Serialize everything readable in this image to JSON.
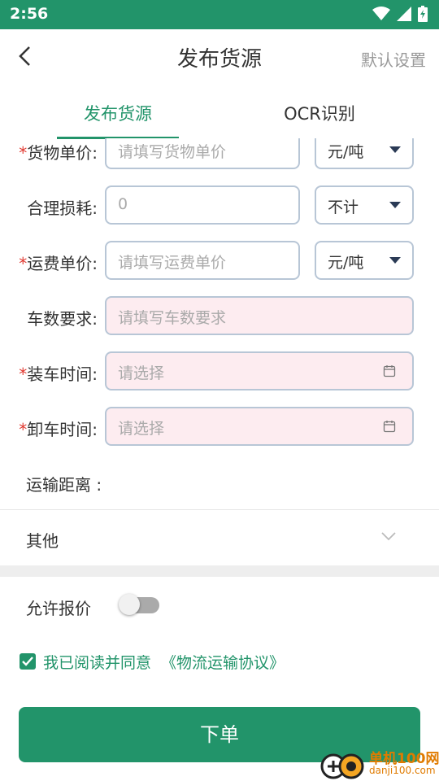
{
  "status_bar": {
    "time": "2:56"
  },
  "header": {
    "title": "发布货源",
    "right_action": "默认设置"
  },
  "tabs": [
    {
      "label": "发布货源",
      "active": true
    },
    {
      "label": "OCR识别",
      "active": false
    }
  ],
  "form": {
    "unit_price": {
      "label": "货物单价:",
      "required": true,
      "placeholder": "请填写货物单价",
      "unit": "元/吨"
    },
    "loss": {
      "label": "合理损耗:",
      "required": false,
      "value": "0",
      "unit": "不计"
    },
    "freight_price": {
      "label": "运费单价:",
      "required": true,
      "placeholder": "请填写运费单价",
      "unit": "元/吨"
    },
    "truck_count": {
      "label": "车数要求:",
      "required": false,
      "placeholder": "请填写车数要求"
    },
    "load_time": {
      "label": "装车时间:",
      "required": true,
      "placeholder": "请选择"
    },
    "unload_time": {
      "label": "卸车时间:",
      "required": true,
      "placeholder": "请选择"
    },
    "distance": {
      "label": "运输距离 :"
    }
  },
  "other": {
    "label": "其他"
  },
  "allow_quote": {
    "label": "允许报价",
    "enabled": false
  },
  "agreement": {
    "checked": true,
    "text": "我已阅读并同意",
    "link": "《物流运输协议》"
  },
  "submit": {
    "label": "下单"
  },
  "watermark": {
    "line1": "单机100网",
    "line2": "danji100.com"
  },
  "colors": {
    "brand": "#22946a",
    "required": "#e0382f",
    "pink_field": "#fdecf0"
  }
}
